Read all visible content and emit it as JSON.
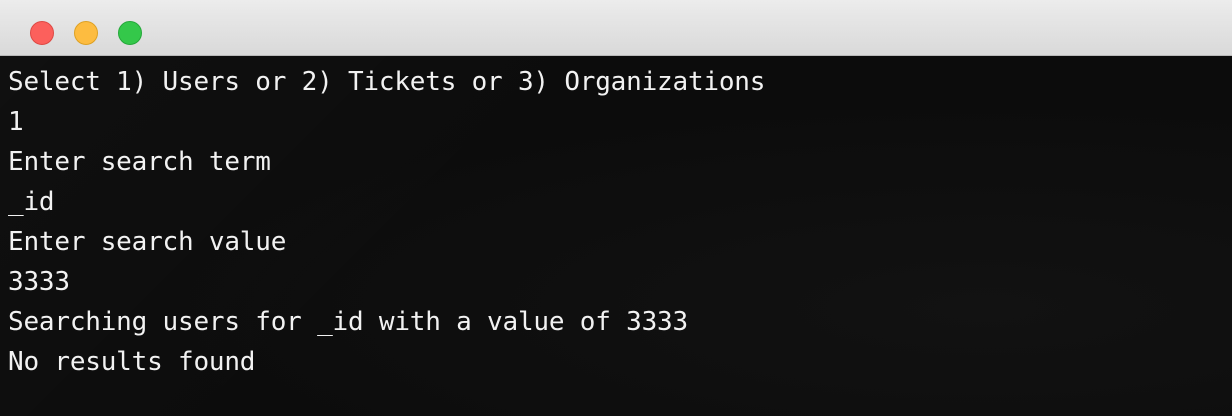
{
  "window": {
    "traffic_lights": {
      "close_color": "#fc605c",
      "minimize_color": "#fdbc40",
      "zoom_color": "#34c84a"
    }
  },
  "terminal": {
    "background": "#0c0c0c",
    "text_color": "#f2f2f2",
    "lines": [
      "Select 1) Users or 2) Tickets or 3) Organizations",
      "1",
      "Enter search term",
      "_id",
      "Enter search value",
      "3333",
      "Searching users for _id with a value of 3333",
      "No results found"
    ]
  }
}
